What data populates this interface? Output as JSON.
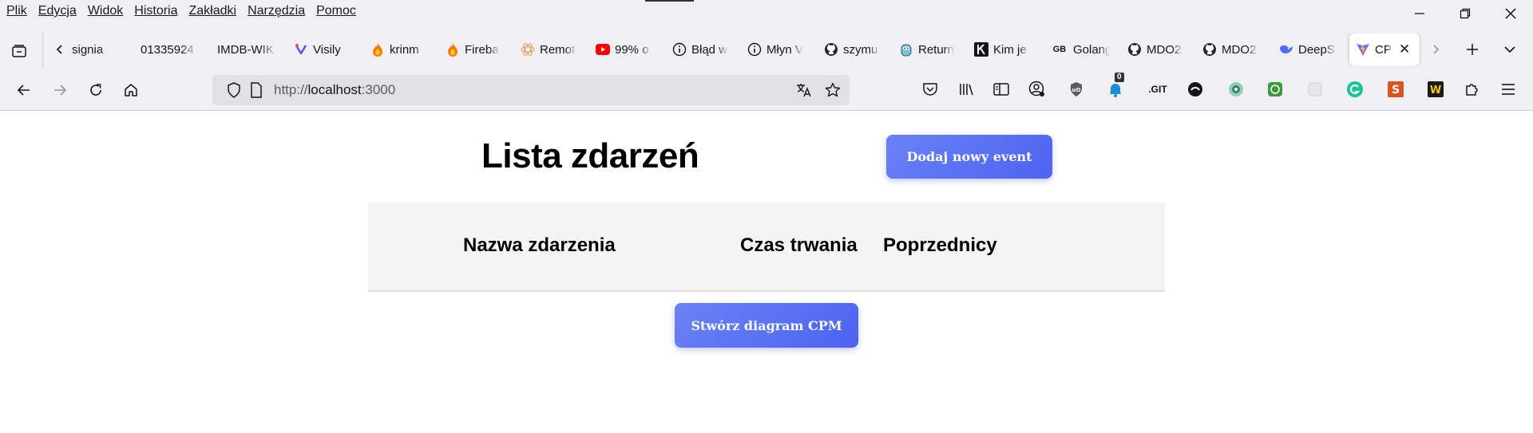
{
  "browser": {
    "menu": [
      {
        "label": "Plik"
      },
      {
        "label": "Edycja"
      },
      {
        "label": "Widok"
      },
      {
        "label": "Historia"
      },
      {
        "label": "Zakładki"
      },
      {
        "label": "Narzędzia"
      },
      {
        "label": "Pomoc"
      }
    ],
    "tabs": [
      {
        "label": "signia",
        "icon": "blank-favicon"
      },
      {
        "label": "01335924",
        "icon": "blank-favicon"
      },
      {
        "label": "IMDB-WIK",
        "icon": "blank-favicon"
      },
      {
        "label": "Visily",
        "icon": "visily-favicon"
      },
      {
        "label": "krinm",
        "icon": "firebase-favicon"
      },
      {
        "label": "Fireba",
        "icon": "firebase-favicon"
      },
      {
        "label": "Remot",
        "icon": "atom-favicon"
      },
      {
        "label": "99% o",
        "icon": "youtube-favicon"
      },
      {
        "label": "Błąd w",
        "icon": "info-favicon"
      },
      {
        "label": "Młyn V",
        "icon": "info-favicon"
      },
      {
        "label": "szymu",
        "icon": "github-favicon"
      },
      {
        "label": "Return",
        "icon": "gopher-favicon"
      },
      {
        "label": "Kim je",
        "icon": "k-favicon"
      },
      {
        "label": "Golang",
        "icon": "gb-favicon",
        "icon_text": "GB"
      },
      {
        "label": "MDO2",
        "icon": "github-favicon"
      },
      {
        "label": "MDO2",
        "icon": "github-favicon"
      },
      {
        "label": "DeepS",
        "icon": "deepseek-favicon"
      },
      {
        "label": "CPM",
        "icon": "vite-favicon",
        "active": true
      }
    ],
    "url": {
      "prefix": "http://",
      "host": "localhost",
      "suffix": ":3000"
    },
    "badge_count": "0",
    "git_label": ".GIT",
    "colors": {
      "chrome_bg": "#f0f0f4",
      "urlbar_bg": "#e0e0e6"
    }
  },
  "page": {
    "title": "Lista zdarzeń",
    "add_button": "Dodaj nowy event",
    "table": {
      "headers": [
        "Nazwa zdarzenia",
        "Czas trwania",
        "Poprzednicy"
      ],
      "rows": []
    },
    "cpm_button": "Stwórz diagram CPM",
    "colors": {
      "button_gradient_start": "#6b82f5",
      "button_gradient_end": "#4b63f0",
      "table_header_bg": "#f4f4f4"
    }
  }
}
